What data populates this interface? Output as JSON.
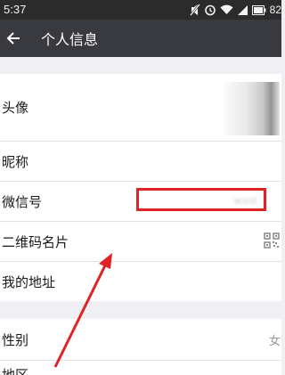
{
  "status_bar": {
    "time": "5:37",
    "battery_text": "82"
  },
  "titlebar": {
    "back_icon": "back-arrow-icon",
    "title": "个人信息"
  },
  "rows": {
    "avatar": {
      "label": "头像"
    },
    "nickname": {
      "label": "昵称"
    },
    "wechat_id": {
      "label": "微信号"
    },
    "qr_card": {
      "label": "二维码名片",
      "icon": "qr-code-icon"
    },
    "address": {
      "label": "我的地址"
    },
    "gender": {
      "label": "性别",
      "value": "女"
    },
    "region": {
      "label": "地区"
    }
  },
  "annotation": {
    "highlight_color": "#e02424"
  }
}
